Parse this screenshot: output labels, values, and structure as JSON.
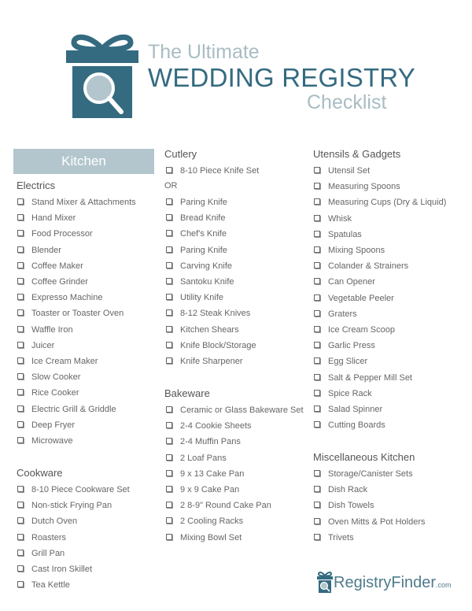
{
  "header": {
    "title_line1": "The Ultimate",
    "title_line2": "WEDDING REGISTRY",
    "title_line3": "Checklist",
    "logo_icon": "gift-magnifier-icon"
  },
  "colors": {
    "primary": "#346b80",
    "light": "#a9bcc4",
    "banner": "#b3c6cd",
    "text": "#666666"
  },
  "banner": {
    "label": "Kitchen"
  },
  "sections": {
    "electrics": {
      "title": "Electrics",
      "items": [
        "Stand Mixer & Attachments",
        "Hand Mixer",
        "Food Processor",
        "Blender",
        "Coffee Maker",
        "Coffee Grinder",
        "Expresso Machine",
        "Toaster or Toaster Oven",
        "Waffle Iron",
        "Juicer",
        "Ice Cream Maker",
        "Slow Cooker",
        "Rice Cooker",
        "Electric Grill & Griddle",
        "Deep Fryer",
        "Microwave"
      ]
    },
    "cookware": {
      "title": "Cookware",
      "items": [
        "8-10 Piece Cookware Set",
        "Non-stick Frying Pan",
        "Dutch Oven",
        "Roasters",
        "Grill Pan",
        "Cast Iron Skillet",
        "Tea Kettle"
      ]
    },
    "cutlery": {
      "title": "Cutlery",
      "first_item": "8-10 Piece Knife Set",
      "or_label": "OR",
      "items": [
        "Paring Knife",
        "Bread Knife",
        "Chef's Knife",
        "Paring Knife",
        "Carving Knife",
        "Santoku Knife",
        "Utility Knife",
        "8-12 Steak Knives",
        "Kitchen Shears",
        "Knife Block/Storage",
        "Knife Sharpener"
      ]
    },
    "bakeware": {
      "title": "Bakeware",
      "items": [
        "Ceramic or Glass Bakeware Set",
        "2-4 Cookie Sheets",
        "2-4 Muffin Pans",
        "2 Loaf Pans",
        "9 x 13 Cake Pan",
        "9 x 9 Cake Pan",
        "2 8-9\" Round Cake Pan",
        "2 Cooling Racks",
        "Mixing Bowl Set"
      ]
    },
    "utensils": {
      "title": "Utensils & Gadgets",
      "items": [
        "Utensil Set",
        "Measuring Spoons",
        "Measuring Cups (Dry & Liquid)",
        "Whisk",
        "Spatulas",
        "Mixing Spoons",
        "Colander & Strainers",
        "Can Opener",
        "Vegetable Peeler",
        "Graters",
        "Ice Cream Scoop",
        "Garlic Press",
        "Egg Slicer",
        "Salt & Pepper Mill Set",
        "Spice Rack",
        "Salad Spinner",
        "Cutting Boards"
      ]
    },
    "misc": {
      "title": "Miscellaneous Kitchen",
      "items": [
        "Storage/Canister Sets",
        "Dish Rack",
        "Dish Towels",
        "Oven Mitts & Pot Holders",
        "Trivets"
      ]
    }
  },
  "footer": {
    "brand": "RegistryFinder",
    "suffix": ".com",
    "logo_icon": "gift-magnifier-icon"
  }
}
